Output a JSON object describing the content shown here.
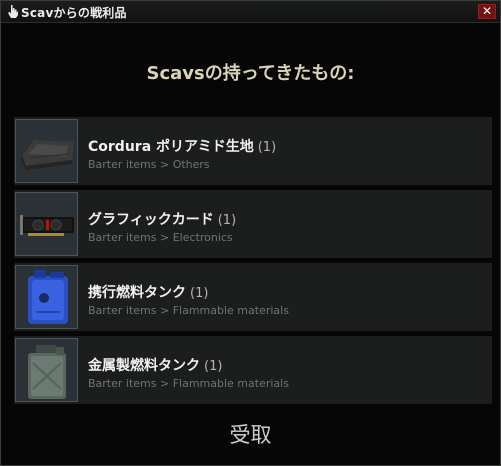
{
  "window": {
    "title": "Scavからの戦利品",
    "close_label": "✕"
  },
  "heading": "Scavsの持ってきたもの:",
  "items": [
    {
      "name": "Cordura ポリアミド生地",
      "count": "(1)",
      "category": "Barter items > Others",
      "icon": "folded-fabric-icon"
    },
    {
      "name": "グラフィックカード",
      "count": "(1)",
      "category": "Barter items > Electronics",
      "icon": "graphics-card-icon"
    },
    {
      "name": "携行燃料タンク",
      "count": "(1)",
      "category": "Barter items > Flammable materials",
      "icon": "blue-fuel-can-icon"
    },
    {
      "name": "金属製燃料タンク",
      "count": "(1)",
      "category": "Barter items > Flammable materials",
      "icon": "metal-fuel-can-icon"
    }
  ],
  "receive_label": "受取",
  "colors": {
    "heading": "#d8d4b8",
    "thumb_bg": "#2a3238",
    "row_bg": "#1c1d1d"
  }
}
